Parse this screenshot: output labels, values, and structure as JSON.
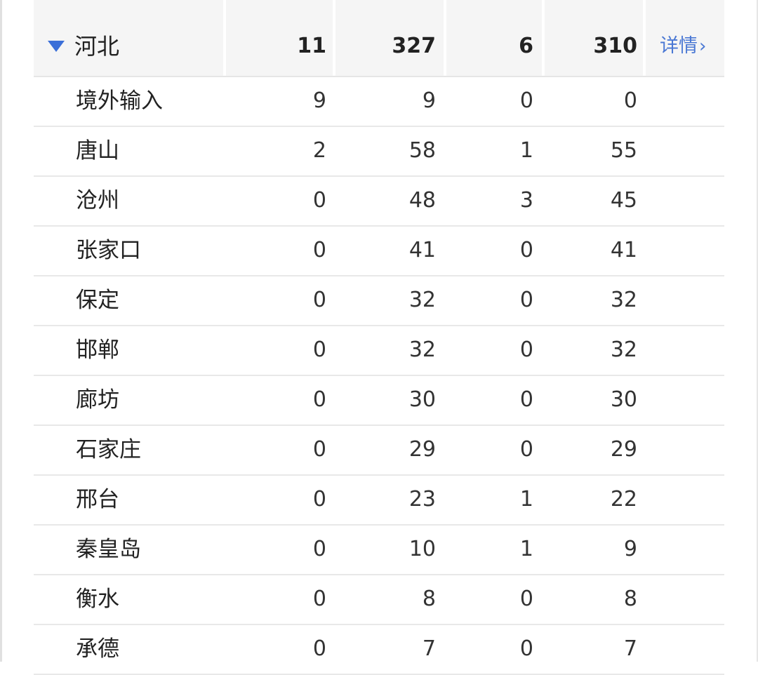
{
  "province": {
    "name": "河北",
    "stats": [
      "11",
      "327",
      "6",
      "310"
    ],
    "detail_label": "详情",
    "detail_chevron": "›"
  },
  "rows": [
    {
      "name": "境外输入",
      "v": [
        "9",
        "9",
        "0",
        "0"
      ]
    },
    {
      "name": "唐山",
      "v": [
        "2",
        "58",
        "1",
        "55"
      ]
    },
    {
      "name": "沧州",
      "v": [
        "0",
        "48",
        "3",
        "45"
      ]
    },
    {
      "name": "张家口",
      "v": [
        "0",
        "41",
        "0",
        "41"
      ]
    },
    {
      "name": "保定",
      "v": [
        "0",
        "32",
        "0",
        "32"
      ]
    },
    {
      "name": "邯郸",
      "v": [
        "0",
        "32",
        "0",
        "32"
      ]
    },
    {
      "name": "廊坊",
      "v": [
        "0",
        "30",
        "0",
        "30"
      ]
    },
    {
      "name": "石家庄",
      "v": [
        "0",
        "29",
        "0",
        "29"
      ]
    },
    {
      "name": "邢台",
      "v": [
        "0",
        "23",
        "1",
        "22"
      ]
    },
    {
      "name": "秦皇岛",
      "v": [
        "0",
        "10",
        "1",
        "9"
      ]
    },
    {
      "name": "衡水",
      "v": [
        "0",
        "8",
        "0",
        "8"
      ]
    },
    {
      "name": "承德",
      "v": [
        "0",
        "7",
        "0",
        "7"
      ]
    }
  ],
  "colors": {
    "accent": "#3b6fd8",
    "link": "#4a78d4",
    "header_bg": "#f5f5f5",
    "divider": "#e8e8e8"
  },
  "icons": {
    "expand": "triangle-down-icon",
    "detail": "chevron-right-icon"
  }
}
